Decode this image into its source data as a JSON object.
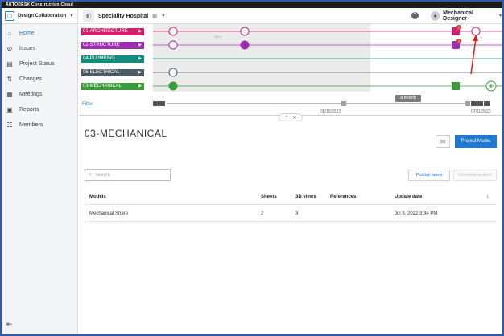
{
  "topbar": {
    "brand": "AUTODESK Construction Cloud"
  },
  "header": {
    "module": "Design Collaboration",
    "project": "Speciality Hospital",
    "user": "Mechanical Designer"
  },
  "sidebar": {
    "items": [
      {
        "label": "Home",
        "icon": "home-icon",
        "active": true
      },
      {
        "label": "Issues",
        "icon": "issues-icon"
      },
      {
        "label": "Project Status",
        "icon": "project-status-icon"
      },
      {
        "label": "Changes",
        "icon": "changes-icon"
      },
      {
        "label": "Meetings",
        "icon": "meetings-icon"
      },
      {
        "label": "Reports",
        "icon": "reports-icon"
      },
      {
        "label": "Members",
        "icon": "members-icon"
      }
    ]
  },
  "timeline": {
    "packages": [
      {
        "label": "01-ARCHITECTURE",
        "color": "#d4206c"
      },
      {
        "label": "02-STRUCTURE",
        "color": "#9b2fae"
      },
      {
        "label": "04-PLUMBING",
        "color": "#118c7e"
      },
      {
        "label": "05-ELECTRICAL",
        "color": "#4a5a66"
      },
      {
        "label": "03-MECHANICAL",
        "color": "#3a9a3a"
      }
    ],
    "filter": "Filter",
    "week_marker": "Sync",
    "range": "a month",
    "start_date": "06/10/2022",
    "end_date": "07/11/2022",
    "badge_count": "2"
  },
  "content": {
    "title": "03-MECHANICAL",
    "project_model": "Project Model",
    "search_placeholder": "Search",
    "publish_latest": "Publish latest",
    "schedule_publish": "Schedule publish"
  },
  "table": {
    "columns": [
      "Models",
      "Sheets",
      "3D views",
      "References",
      "Update date"
    ],
    "rows": [
      {
        "model": "Mechanical Share",
        "sheets": "2",
        "views": "3",
        "references": "",
        "updated": "Jul 9, 2022 3:34 PM"
      }
    ]
  }
}
